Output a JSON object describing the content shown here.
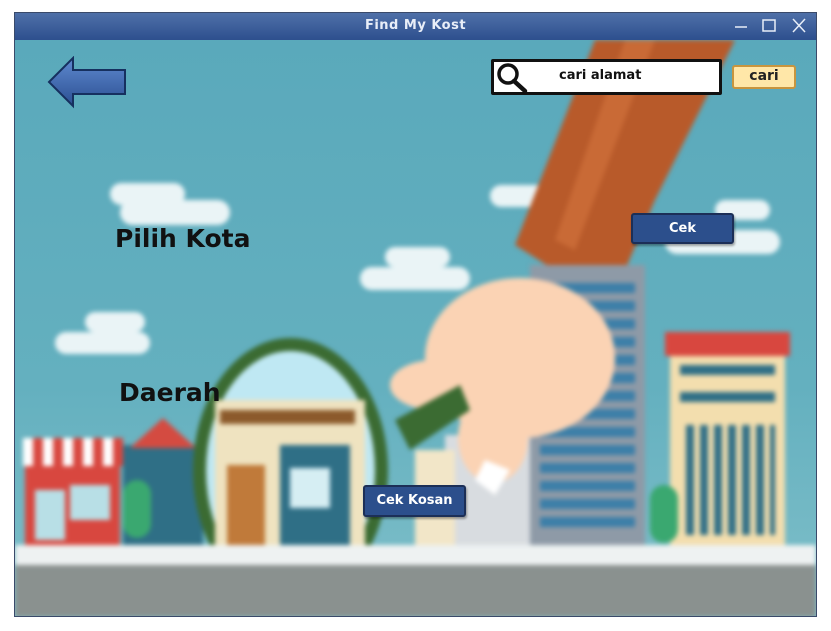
{
  "window": {
    "title": "Find My Kost"
  },
  "window_controls": {
    "minimize_icon": "minimize-icon",
    "maximize_icon": "maximize-icon",
    "close_icon": "close-icon"
  },
  "nav": {
    "back_icon": "arrow-left-icon"
  },
  "search": {
    "value": "cari alamat",
    "icon": "magnifier-icon",
    "button_label": "cari"
  },
  "labels": {
    "city": "Pilih Kota",
    "area": "Daerah"
  },
  "buttons": {
    "cek": "Cek",
    "cek_kosan": "Cek Kosan"
  },
  "colors": {
    "accent": "#2c4f8c",
    "cari_button": "#ffe7a8",
    "sky": "#5aa9bb"
  }
}
